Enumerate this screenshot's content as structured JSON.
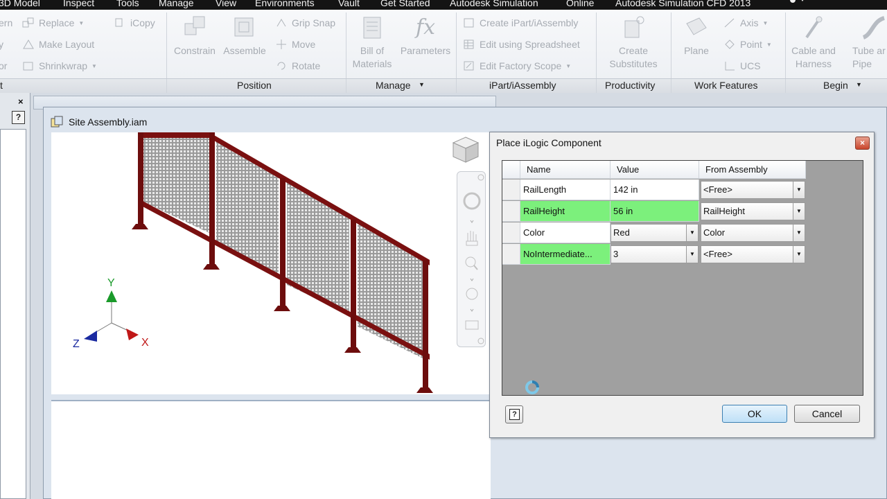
{
  "menubar": {
    "items": [
      "3D Model",
      "Inspect",
      "Tools",
      "Manage",
      "View",
      "Environments",
      "Vault",
      "Get Started",
      "Autodesk Simulation",
      "Online",
      "Autodesk Simulation CFD 2013"
    ]
  },
  "ribbon": {
    "left_partial": {
      "row1": "ern",
      "row2": "y",
      "row3": "or",
      "panel": "t"
    },
    "component": {
      "replace": "Replace",
      "make_layout": "Make Layout",
      "shrinkwrap": "Shrinkwrap",
      "icopy": "iCopy"
    },
    "position": {
      "constrain": "Constrain",
      "assemble": "Assemble",
      "grip_snap": "Grip Snap",
      "move": "Move",
      "rotate": "Rotate",
      "panel": "Position"
    },
    "manage": {
      "bom_line1": "Bill of",
      "bom_line2": "Materials",
      "parameters": "Parameters",
      "panel": "Manage"
    },
    "ipart": {
      "create": "Create iPart/iAssembly",
      "edit_spreadsheet": "Edit using Spreadsheet",
      "edit_factory": "Edit Factory Scope",
      "panel": "iPart/iAssembly"
    },
    "productivity": {
      "create_line1": "Create",
      "create_line2": "Substitutes",
      "panel": "Productivity"
    },
    "work_features": {
      "plane": "Plane",
      "axis": "Axis",
      "point": "Point",
      "ucs": "UCS",
      "panel": "Work Features"
    },
    "begin": {
      "cable_line1": "Cable and",
      "cable_line2": "Harness",
      "tube_line1": "Tube ar",
      "tube_line2": "Pipe",
      "panel": "Begin"
    }
  },
  "browser": {
    "close": "×",
    "help": "?"
  },
  "document": {
    "title": "Site Assembly.iam"
  },
  "triad": {
    "x": "X",
    "y": "Y",
    "z": "Z"
  },
  "dialog": {
    "title": "Place iLogic Component",
    "close": "×",
    "columns": [
      "Name",
      "Value",
      "From Assembly"
    ],
    "rows": [
      {
        "name": "RailLength",
        "value": "142 in",
        "from": "<Free>",
        "highlight": false,
        "value_dropdown": false
      },
      {
        "name": "RailHeight",
        "value": "56 in",
        "from": "RailHeight",
        "highlight": true,
        "value_dropdown": false
      },
      {
        "name": "Color",
        "value": "Red",
        "from": "Color",
        "highlight": false,
        "value_dropdown": true
      },
      {
        "name": "NoIntermediate...",
        "value": "3",
        "from": "<Free>",
        "highlight": true,
        "value_dropdown": true
      }
    ],
    "ok": "OK",
    "cancel": "Cancel",
    "help": "?"
  },
  "colors": {
    "highlight": "#7cf07c",
    "rail": "#7a1010",
    "menubar": "#141414"
  }
}
